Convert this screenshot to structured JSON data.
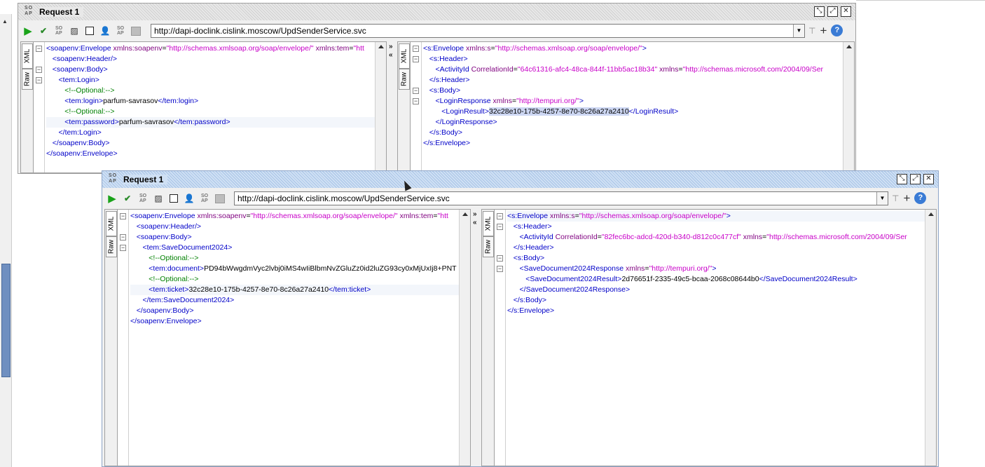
{
  "windows": [
    {
      "title": "Request 1",
      "url": "http://dapi-doclink.cislink.moscow/UpdSenderService.svc",
      "tabs": {
        "xml": "XML",
        "raw": "Raw"
      },
      "request_lines": [
        [
          [
            "tg",
            "<soapenv:Envelope "
          ],
          [
            "at",
            "xmlns:soapenv"
          ],
          [
            "tx",
            "="
          ],
          [
            "vl",
            "\"http://schemas.xmlsoap.org/soap/envelope/\""
          ],
          [
            "tx",
            " "
          ],
          [
            "at",
            "xmlns:tem"
          ],
          [
            "tx",
            "="
          ],
          [
            "vl",
            "\"htt"
          ]
        ],
        [
          [
            "tx",
            "   "
          ],
          [
            "tg",
            "<soapenv:Header/>"
          ]
        ],
        [
          [
            "tx",
            "   "
          ],
          [
            "tg",
            "<soapenv:Body>"
          ]
        ],
        [
          [
            "tx",
            "      "
          ],
          [
            "tg",
            "<tem:Login>"
          ]
        ],
        [
          [
            "tx",
            "         "
          ],
          [
            "cm",
            "<!--Optional:-->"
          ]
        ],
        [
          [
            "tx",
            "         "
          ],
          [
            "tg",
            "<tem:login>"
          ],
          [
            "tx",
            "parfum-savrasov"
          ],
          [
            "tg",
            "</tem:login>"
          ]
        ],
        [
          [
            "tx",
            "         "
          ],
          [
            "cm",
            "<!--Optional:-->"
          ]
        ],
        [
          [
            "tx",
            "         "
          ],
          [
            "tg",
            "<tem:password>"
          ],
          [
            "tx",
            "parfum-savrasov"
          ],
          [
            "tg",
            "</tem:password>"
          ]
        ],
        [
          [
            "tx",
            "      "
          ],
          [
            "tg",
            "</tem:Login>"
          ]
        ],
        [
          [
            "tx",
            "   "
          ],
          [
            "tg",
            "</soapenv:Body>"
          ]
        ],
        [
          [
            "tg",
            "</soapenv:Envelope>"
          ]
        ]
      ],
      "response_lines": [
        [
          [
            "tg",
            "<s:Envelope "
          ],
          [
            "at",
            "xmlns:s"
          ],
          [
            "tx",
            "="
          ],
          [
            "vl",
            "\"http://schemas.xmlsoap.org/soap/envelope/\""
          ],
          [
            "tg",
            ">"
          ]
        ],
        [
          [
            "tx",
            "   "
          ],
          [
            "tg",
            "<s:Header>"
          ]
        ],
        [
          [
            "tx",
            "      "
          ],
          [
            "tg",
            "<ActivityId "
          ],
          [
            "at",
            "CorrelationId"
          ],
          [
            "tx",
            "="
          ],
          [
            "vl",
            "\"64c61316-afc4-48ca-844f-11bb5ac18b34\""
          ],
          [
            "tx",
            " "
          ],
          [
            "at",
            "xmlns"
          ],
          [
            "tx",
            "="
          ],
          [
            "vl",
            "\"http://schemas.microsoft.com/2004/09/Ser"
          ]
        ],
        [
          [
            "tx",
            "   "
          ],
          [
            "tg",
            "</s:Header>"
          ]
        ],
        [
          [
            "tx",
            "   "
          ],
          [
            "tg",
            "<s:Body>"
          ]
        ],
        [
          [
            "tx",
            "      "
          ],
          [
            "tg",
            "<LoginResponse "
          ],
          [
            "at",
            "xmlns"
          ],
          [
            "tx",
            "="
          ],
          [
            "vl",
            "\"http://tempuri.org/\""
          ],
          [
            "tg",
            ">"
          ]
        ],
        [
          [
            "tx",
            "         "
          ],
          [
            "tg",
            "<LoginResult>"
          ],
          [
            "sel",
            "32c28e10-175b-4257-8e70-8c26a27a2410"
          ],
          [
            "tg",
            "</LoginResult>"
          ]
        ],
        [
          [
            "tx",
            "      "
          ],
          [
            "tg",
            "</LoginResponse>"
          ]
        ],
        [
          [
            "tx",
            "   "
          ],
          [
            "tg",
            "</s:Body>"
          ]
        ],
        [
          [
            "tg",
            "</s:Envelope>"
          ]
        ]
      ]
    },
    {
      "title": "Request 1",
      "url": "http://dapi-doclink.cislink.moscow/UpdSenderService.svc",
      "tabs": {
        "xml": "XML",
        "raw": "Raw"
      },
      "request_lines": [
        [
          [
            "tg",
            "<soapenv:Envelope "
          ],
          [
            "at",
            "xmlns:soapenv"
          ],
          [
            "tx",
            "="
          ],
          [
            "vl",
            "\"http://schemas.xmlsoap.org/soap/envelope/\""
          ],
          [
            "tx",
            " "
          ],
          [
            "at",
            "xmlns:tem"
          ],
          [
            "tx",
            "="
          ],
          [
            "vl",
            "\"htt"
          ]
        ],
        [
          [
            "tx",
            "   "
          ],
          [
            "tg",
            "<soapenv:Header/>"
          ]
        ],
        [
          [
            "tx",
            "   "
          ],
          [
            "tg",
            "<soapenv:Body>"
          ]
        ],
        [
          [
            "tx",
            "      "
          ],
          [
            "tg",
            "<tem:SaveDocument2024>"
          ]
        ],
        [
          [
            "tx",
            "         "
          ],
          [
            "cm",
            "<!--Optional:-->"
          ]
        ],
        [
          [
            "tx",
            "         "
          ],
          [
            "tg",
            "<tem:document>"
          ],
          [
            "tx",
            "PD94bWwgdmVyc2lvbj0iMS4wIiBlbmNvZGluZz0id2luZG93cy0xMjUxIj8+PNT"
          ]
        ],
        [
          [
            "tx",
            "         "
          ],
          [
            "cm",
            "<!--Optional:-->"
          ]
        ],
        [
          [
            "tx",
            "         "
          ],
          [
            "tg",
            "<tem:ticket>"
          ],
          [
            "tx",
            "32c28e10-175b-4257-8e70-8c26a27a2410"
          ],
          [
            "tg",
            "</tem:ticket>"
          ]
        ],
        [
          [
            "tx",
            "      "
          ],
          [
            "tg",
            "</tem:SaveDocument2024>"
          ]
        ],
        [
          [
            "tx",
            "   "
          ],
          [
            "tg",
            "</soapenv:Body>"
          ]
        ],
        [
          [
            "tg",
            "</soapenv:Envelope>"
          ]
        ]
      ],
      "response_lines": [
        [
          [
            "tg",
            "<s:Envelope "
          ],
          [
            "at",
            "xmlns:s"
          ],
          [
            "tx",
            "="
          ],
          [
            "vl",
            "\"http://schemas.xmlsoap.org/soap/envelope/\""
          ],
          [
            "tg",
            ">"
          ]
        ],
        [
          [
            "tx",
            "   "
          ],
          [
            "tg",
            "<s:Header>"
          ]
        ],
        [
          [
            "tx",
            "      "
          ],
          [
            "tg",
            "<ActivityId "
          ],
          [
            "at",
            "CorrelationId"
          ],
          [
            "tx",
            "="
          ],
          [
            "vl",
            "\"82fec6bc-adcd-420d-b340-d812c0c477cf\""
          ],
          [
            "tx",
            " "
          ],
          [
            "at",
            "xmlns"
          ],
          [
            "tx",
            "="
          ],
          [
            "vl",
            "\"http://schemas.microsoft.com/2004/09/Ser"
          ]
        ],
        [
          [
            "tx",
            "   "
          ],
          [
            "tg",
            "</s:Header>"
          ]
        ],
        [
          [
            "tx",
            "   "
          ],
          [
            "tg",
            "<s:Body>"
          ]
        ],
        [
          [
            "tx",
            "      "
          ],
          [
            "tg",
            "<SaveDocument2024Response "
          ],
          [
            "at",
            "xmlns"
          ],
          [
            "tx",
            "="
          ],
          [
            "vl",
            "\"http://tempuri.org/\""
          ],
          [
            "tg",
            ">"
          ]
        ],
        [
          [
            "tx",
            "         "
          ],
          [
            "tg",
            "<SaveDocument2024Result>"
          ],
          [
            "tx",
            "2d76651f-2335-49c5-bcaa-2068c08644b0"
          ],
          [
            "tg",
            "</SaveDocument2024Result>"
          ]
        ],
        [
          [
            "tx",
            "      "
          ],
          [
            "tg",
            "</SaveDocument2024Response>"
          ]
        ],
        [
          [
            "tx",
            "   "
          ],
          [
            "tg",
            "</s:Body>"
          ]
        ],
        [
          [
            "tg",
            "</s:Envelope>"
          ]
        ]
      ]
    }
  ],
  "icons": {
    "run": "play-icon",
    "validate": "check-icon",
    "stop": "stop-icon",
    "help": "help-icon"
  }
}
